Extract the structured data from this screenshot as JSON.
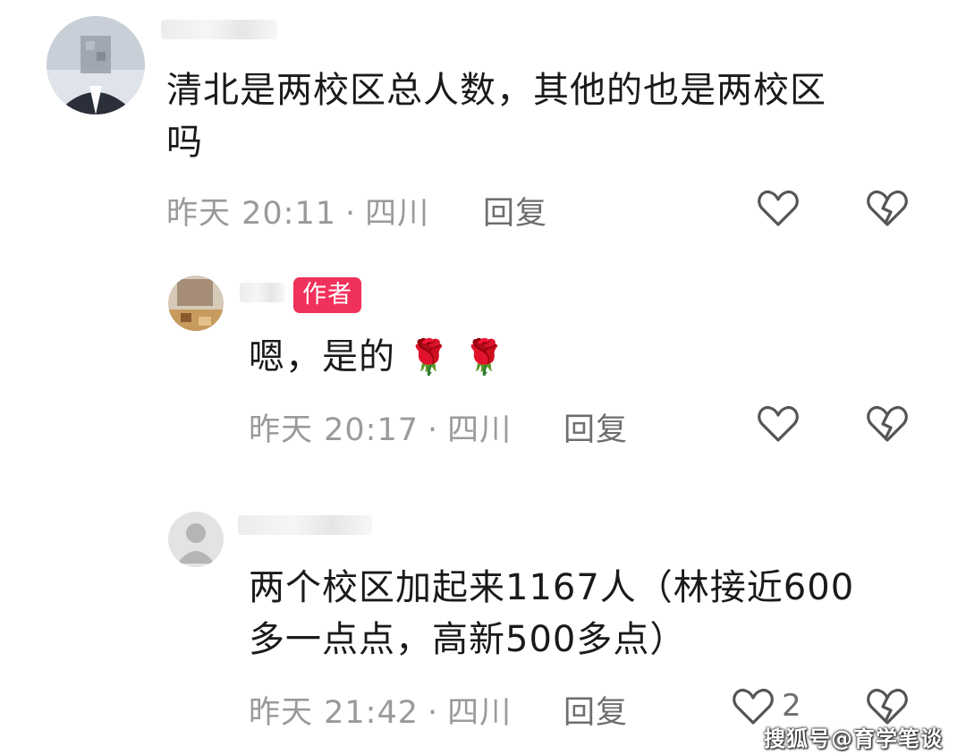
{
  "comments": [
    {
      "text_line1": "清北是两校区总人数，其他的也是两校区",
      "text_line2": "吗",
      "time": "昨天 20:11",
      "location": "四川",
      "separator": "·",
      "reply_label": "回复"
    },
    {
      "badge": "作者",
      "text": "嗯，是的",
      "emoji_1": "🌹",
      "emoji_2": "🌹",
      "time": "昨天 20:17",
      "location": "四川",
      "separator": "·",
      "reply_label": "回复"
    },
    {
      "text_line1": "两个校区加起来1167人（林接近600",
      "text_line2": "多一点点，高新500多点）",
      "time": "昨天 21:42",
      "location": "四川",
      "separator": "·",
      "reply_label": "回复",
      "like_count": "2"
    }
  ],
  "icons": {
    "like": "heart-outline-icon",
    "dislike": "broken-heart-icon"
  },
  "colors": {
    "author_badge": "#f0315b",
    "meta_text": "#9a9a9a",
    "icon_stroke": "#555555"
  },
  "watermark": "搜狐号@育学笔谈"
}
